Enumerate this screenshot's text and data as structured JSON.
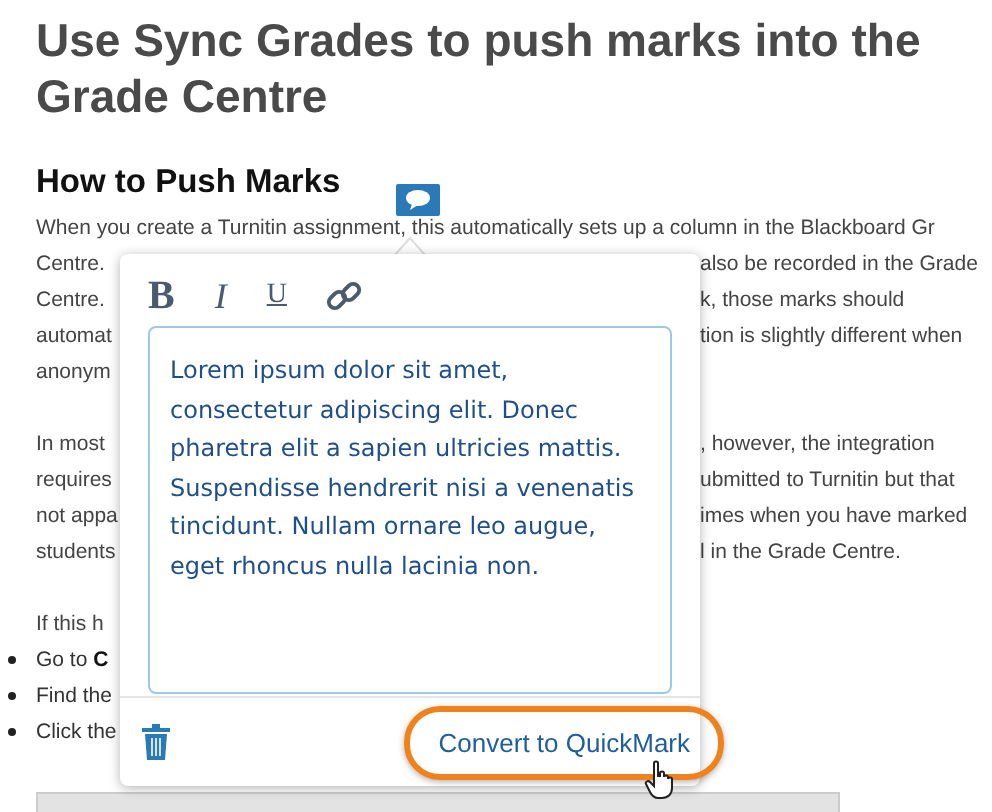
{
  "article": {
    "title": "Use Sync Grades to push marks into the Grade Centre",
    "heading": "How to Push Marks",
    "first_line": "When you create a Turnitin assignment, this automatically sets up a column in the Blackboard Gr",
    "paragraph_1": [
      {
        "left": "Centre.",
        "right": "also be recorded in the Grade"
      },
      {
        "left": "Centre.",
        "right": "k, those marks should"
      },
      {
        "left": "automat",
        "right": "tion is slightly different when"
      },
      {
        "left": "anonym"
      }
    ],
    "paragraph_2": [
      {
        "left": "In most",
        "right": ", however, the integration"
      },
      {
        "left": "requires",
        "right": "ubmitted to Turnitin but that"
      },
      {
        "left": "not appa",
        "right": "imes when you have marked"
      },
      {
        "left": "students",
        "right": "l in the Grade Centre."
      }
    ],
    "paragraph_3": "If this h",
    "bullets": [
      "Go to **C**",
      "Find the",
      "Click the"
    ]
  },
  "comment_popup": {
    "format_buttons": [
      {
        "label": "B",
        "kind": "bold"
      },
      {
        "label": "I",
        "kind": "italic"
      },
      {
        "label": "U",
        "kind": "underline"
      }
    ],
    "comment_text": "Lorem ipsum dolor sit amet, consectetur adipiscing elit. Donec pharetra elit a sapien ultricies mattis. Suspendisse hendrerit nisi a venenatis tincidunt. Nullam ornare leo augue, eget rhoncus nulla lacinia non.",
    "convert_button": {
      "label": "Convert to QuickMark",
      "highlighted": true
    }
  }
}
